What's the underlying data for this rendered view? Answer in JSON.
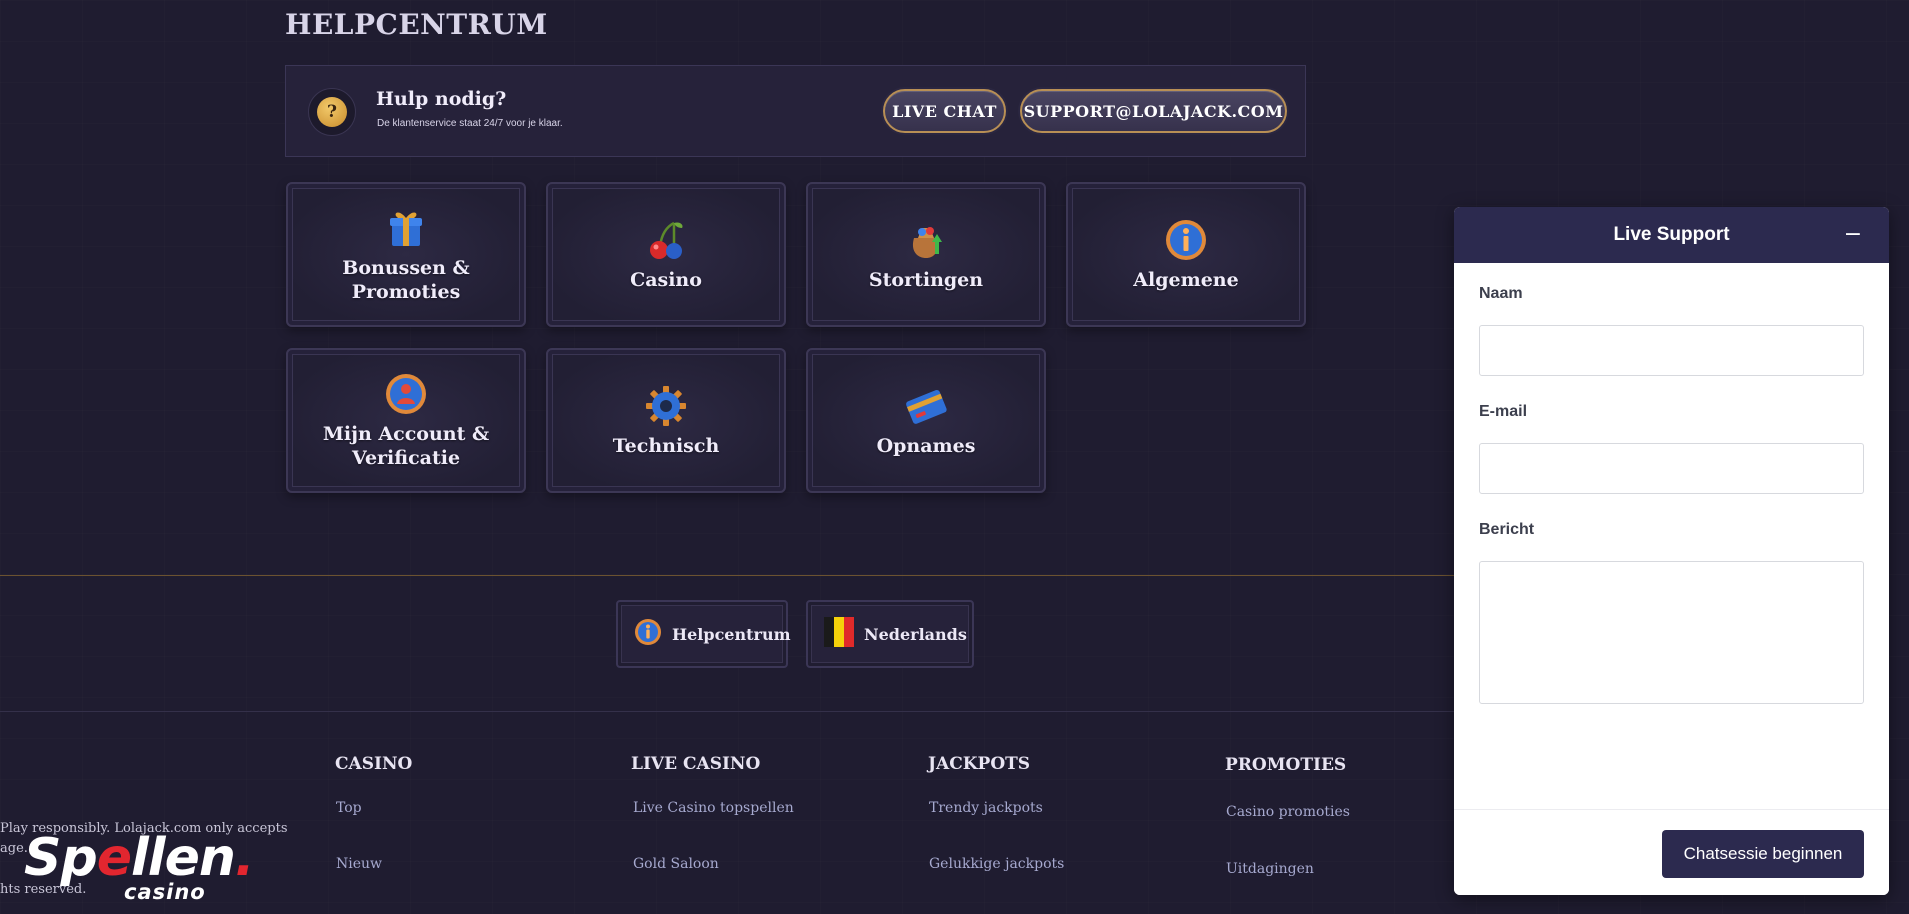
{
  "help_center": {
    "title": "HELPCENTRUM",
    "help_bar": {
      "title": "Hulp nodig?",
      "subtitle": "De klantenservice staat 24/7 voor je klaar.",
      "live_chat_label": "LIVE CHAT",
      "email_label": "SUPPORT@LOLAJACK.COM"
    },
    "categories": [
      {
        "label": "Bonussen & Promoties",
        "icon": "gift-icon"
      },
      {
        "label": "Casino",
        "icon": "cherries-icon"
      },
      {
        "label": "Stortingen",
        "icon": "money-bag-icon"
      },
      {
        "label": "Algemene",
        "icon": "info-icon"
      },
      {
        "label": "Mijn Account & Verificatie",
        "icon": "user-icon"
      },
      {
        "label": "Technisch",
        "icon": "cog-icon"
      },
      {
        "label": "Opnames",
        "icon": "card-icon"
      }
    ]
  },
  "footer": {
    "help_button": "Helpcentrum",
    "language_button": "Nederlands",
    "columns": [
      {
        "heading": "CASINO",
        "links": [
          "Top",
          "Nieuw"
        ]
      },
      {
        "heading": "LIVE CASINO",
        "links": [
          "Live Casino topspellen",
          "Gold Saloon"
        ]
      },
      {
        "heading": "JACKPOTS",
        "links": [
          "Trendy jackpots",
          "Gelukkige jackpots"
        ]
      },
      {
        "heading": "PROMOTIES",
        "links": [
          "Casino promoties",
          "Uitdagingen"
        ]
      }
    ],
    "legal_line1": "Play responsibly. Lolajack.com only accepts",
    "legal_line2": "age.",
    "legal_line3": "hts reserved."
  },
  "logo": {
    "text_before": "Sp",
    "text_e": "e",
    "text_after": "llen",
    "dot": ".",
    "sub": "casino"
  },
  "live_support": {
    "title": "Live Support",
    "minimize_symbol": "−",
    "name_label": "Naam",
    "email_label": "E-mail",
    "message_label": "Bericht",
    "name_value": "",
    "email_value": "",
    "message_value": "",
    "submit_label": "Chatsessie beginnen"
  },
  "colors": {
    "background": "#1f1c30",
    "widget_header": "#2c2a4f",
    "pill_border": "#b88f55",
    "link": "#a6a9cf"
  }
}
